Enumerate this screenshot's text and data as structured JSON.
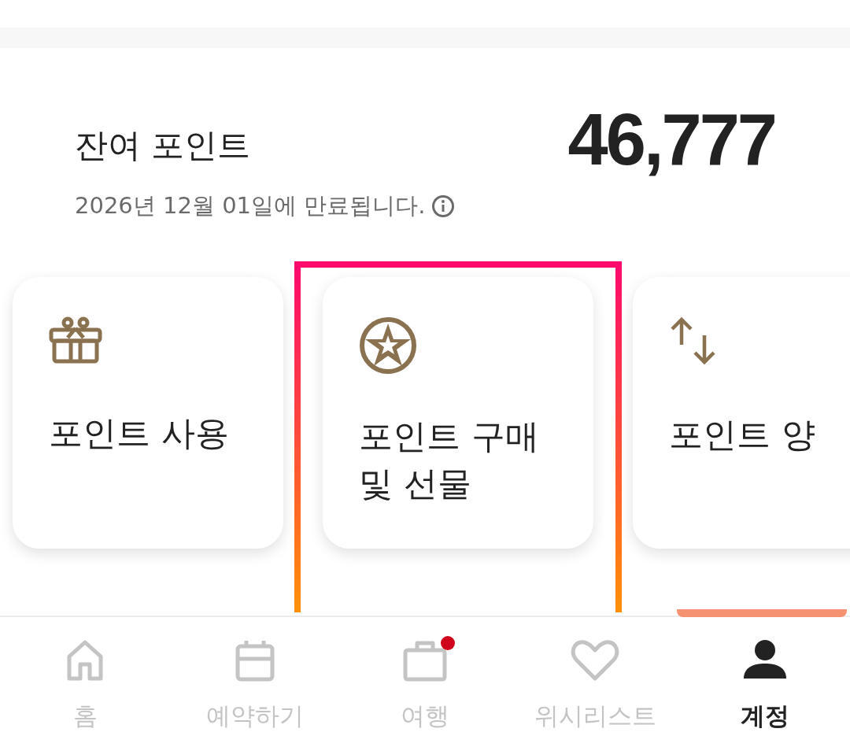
{
  "balance": {
    "title": "잔여 포인트",
    "amount": "46,777",
    "expiry": "2026년 12월 01일에 만료됩니다.",
    "info_icon": true
  },
  "actions": [
    {
      "kind": "gift",
      "label": "포인트 사용",
      "highlighted": false
    },
    {
      "kind": "star",
      "label": "포인트 구매 및 선물",
      "highlighted": true
    },
    {
      "kind": "transfer",
      "label": "포인트 양",
      "highlighted": false
    }
  ],
  "bottom_nav": [
    {
      "kind": "home",
      "label": "홈",
      "selected": false,
      "dot": false
    },
    {
      "kind": "calendar",
      "label": "예약하기",
      "selected": false,
      "dot": false
    },
    {
      "kind": "suitcase",
      "label": "여행",
      "selected": false,
      "dot": true
    },
    {
      "kind": "heart",
      "label": "위시리스트",
      "selected": false,
      "dot": false
    },
    {
      "kind": "person",
      "label": "계정",
      "selected": true,
      "dot": false
    }
  ]
}
